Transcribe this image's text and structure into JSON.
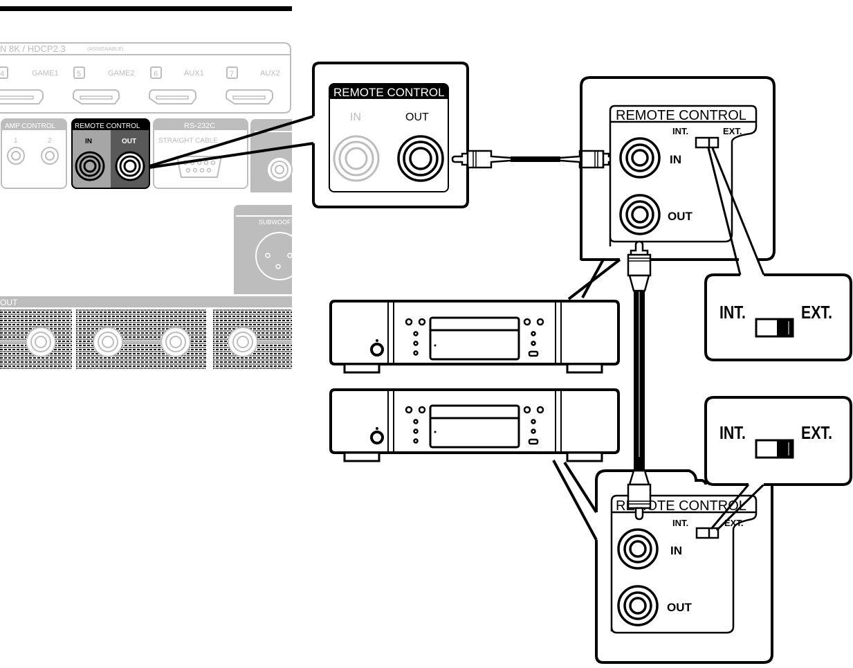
{
  "colors": {
    "ink": "#000000",
    "panel_gray": "#bdbdbd",
    "panel_dark": "#595959",
    "panel_mid": "#a6a6a6",
    "background": "#ffffff"
  },
  "rear_panel": {
    "hdmi_header": "N 8K / HDCP2.3",
    "hdmi_assignable": "(ASSIGNABLE)",
    "hdmi_inputs": [
      {
        "number": "4",
        "label": "GAME1"
      },
      {
        "number": "5",
        "label": "GAME2"
      },
      {
        "number": "6",
        "label": "AUX1"
      },
      {
        "number": "7",
        "label": "AUX2"
      }
    ],
    "amp_control": {
      "title": "AMP CONTROL",
      "ports": [
        "1",
        "2"
      ]
    },
    "remote_control": {
      "title": "REMOTE CONTROL",
      "in_label": "IN",
      "out_label": "OUT"
    },
    "rs232c": {
      "title": "RS-232C",
      "subtitle": "STRAIGHT CABLE"
    },
    "subwoofer_label": "SUBWOOF",
    "speaker_out_label": "OUT"
  },
  "callout_receiver": {
    "title": "REMOTE CONTROL",
    "in_label": "IN",
    "out_label": "OUT"
  },
  "device_top": {
    "title": "REMOTE CONTROL",
    "int_label": "INT.",
    "ext_label": "EXT.",
    "in_label": "IN",
    "out_label": "OUT",
    "switch_position": "EXT."
  },
  "device_bottom": {
    "title": "REMOTE CONTROL",
    "int_label": "INT.",
    "ext_label": "EXT.",
    "in_label": "IN",
    "out_label": "OUT",
    "switch_position": "EXT."
  },
  "switch_zoom_top": {
    "int_label": "INT.",
    "ext_label": "EXT.",
    "position": "EXT."
  },
  "switch_zoom_bottom": {
    "int_label": "INT.",
    "ext_label": "EXT.",
    "position": "EXT."
  },
  "components": [
    {
      "name": "cd-player-top"
    },
    {
      "name": "cd-player-bottom"
    }
  ]
}
